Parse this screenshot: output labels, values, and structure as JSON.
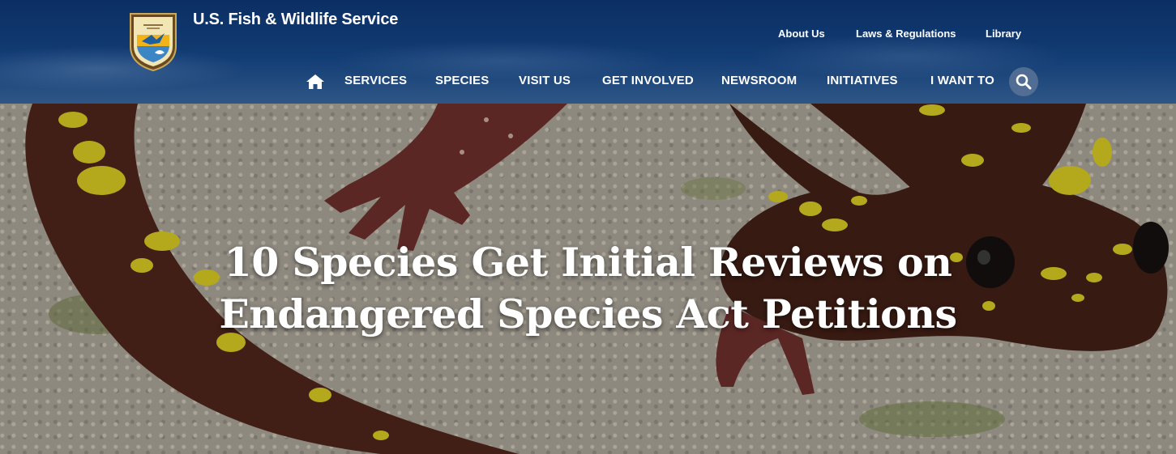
{
  "site": {
    "title": "U.S. Fish & Wildlife Service"
  },
  "utility_nav": {
    "about": "About Us",
    "laws": "Laws & Regulations",
    "library": "Library"
  },
  "main_nav": {
    "home_icon": "home-icon",
    "services": "SERVICES",
    "species": "SPECIES",
    "visit": "VISIT US",
    "involved": "GET INVOLVED",
    "newsroom": "NEWSROOM",
    "initiatives": "INITIATIVES",
    "want": "I WANT TO",
    "search_icon": "search-icon"
  },
  "hero": {
    "title_line1": "10 Species Get Initial Reviews on",
    "title_line2": "Endangered Species Act Petitions"
  },
  "colors": {
    "header_bg": "#0b2f63",
    "header_text": "#ffffff",
    "search_button_bg": "#5a7396",
    "salamander_body": "#4a1f16",
    "salamander_spots": "#d6c81e"
  }
}
